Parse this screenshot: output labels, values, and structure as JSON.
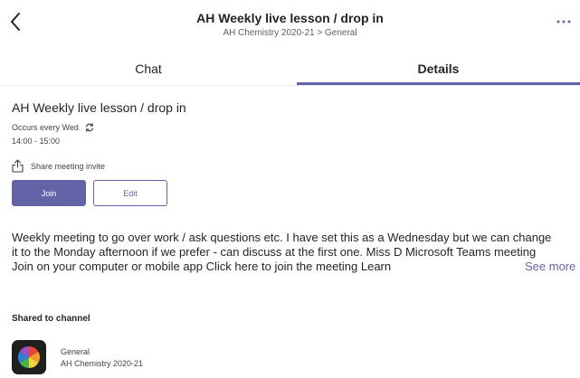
{
  "header": {
    "title": "AH Weekly live lesson / drop in",
    "breadcrumb": "AH Chemistry 2020-21 > General",
    "back_icon": "chevron-left-icon",
    "more_icon": "more-horizontal-icon"
  },
  "tabs": [
    {
      "label": "Chat",
      "selected": false
    },
    {
      "label": "Details",
      "selected": true
    }
  ],
  "meeting": {
    "title": "AH Weekly live lesson / drop in",
    "recurrence": "Occurs every Wed",
    "time": "14:00 - 15:00",
    "share_label": "Share meeting invite",
    "join_label": "Join",
    "edit_label": "Edit",
    "description": "Weekly meeting to go over work / ask questions etc. I have set this as a Wednesday but we can change it to the Monday afternoon if we prefer - can discuss at the first one. Miss D Microsoft Teams meeting Join on your computer or mobile app Click here to join the meeting Learn",
    "see_more_label": "See more"
  },
  "shared": {
    "heading": "Shared to channel",
    "channel_name": "General",
    "team_name": "AH Chemistry 2020-21"
  },
  "colors": {
    "accent": "#6264a7",
    "text": "#242424",
    "secondary_text": "#424242"
  }
}
